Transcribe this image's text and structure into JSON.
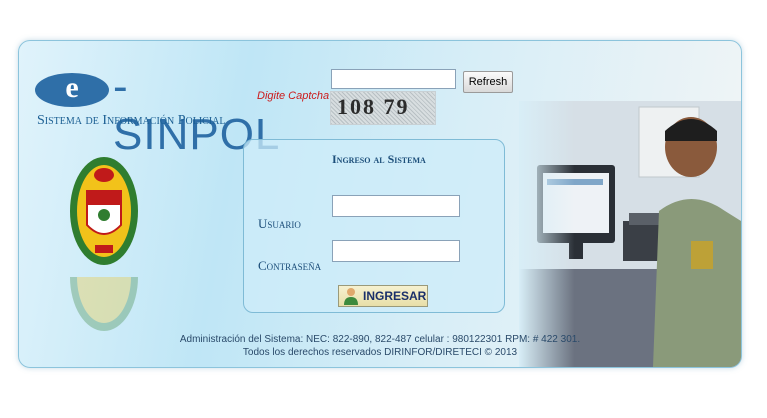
{
  "logo": {
    "letter": "e",
    "title": "-SINPOL",
    "subtitle": "Sistema de Información Policial"
  },
  "captcha": {
    "label": "Digite Captcha",
    "input_value": "",
    "refresh_label": "Refresh",
    "code": "108 79"
  },
  "login": {
    "title": "Ingreso al Sistema",
    "username_label": "Usuario",
    "username_value": "",
    "password_label": "Contraseña",
    "password_value": "",
    "submit_label": "INGRESAR"
  },
  "footer": {
    "admin_line": "Administración del Sistema: NEC: 822-890, 822-487 celular : 980122301 RPM: # 422 301.",
    "rights_line": "Todos los derechos reservados DIRINFOR/DIRETECI",
    "copyright_symbol": "©",
    "year": "2013"
  },
  "colors": {
    "brand_blue": "#2f6fa8",
    "captcha_label_red": "#cc1a1a",
    "login_title_blue": "#1c4e7a"
  },
  "icons": {
    "user_icon": "user-icon",
    "emblem": "police-emblem"
  }
}
